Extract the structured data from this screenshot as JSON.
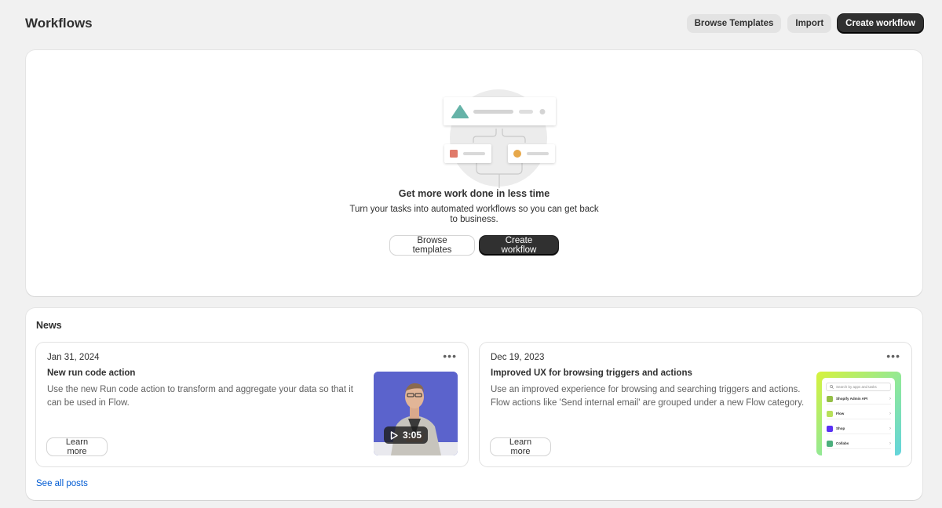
{
  "header": {
    "title": "Workflows",
    "browse_templates_label": "Browse Templates",
    "import_label": "Import",
    "create_workflow_label": "Create workflow"
  },
  "empty_state": {
    "heading": "Get more work done in less time",
    "description": "Turn your tasks into automated workflows so you can get back to business.",
    "browse_templates_label": "Browse templates",
    "create_workflow_label": "Create workflow"
  },
  "news": {
    "title": "News",
    "items": [
      {
        "date": "Jan 31, 2024",
        "title": "New run code action",
        "body": "Use the new Run code action to transform and aggregate your data so that it can be used in Flow.",
        "learn_more_label": "Learn more",
        "more_icon": "ellipsis-icon",
        "video_duration": "3:05"
      },
      {
        "date": "Dec 19, 2023",
        "title": "Improved UX for browsing triggers and actions",
        "body": "Use an improved experience for browsing and searching triggers and actions. Flow actions like 'Send internal email' are grouped under a new Flow category.",
        "learn_more_label": "Learn more",
        "more_icon": "ellipsis-icon",
        "thumbnail": {
          "search_placeholder": "Search by apps and tasks",
          "rows": [
            "Shopify Admin API",
            "Flow",
            "Shop",
            "Collabs"
          ]
        }
      }
    ],
    "see_all_label": "See all posts"
  },
  "colors": {
    "primary_button": "#303030",
    "link": "#005bd3",
    "background": "#f1f1f1"
  }
}
